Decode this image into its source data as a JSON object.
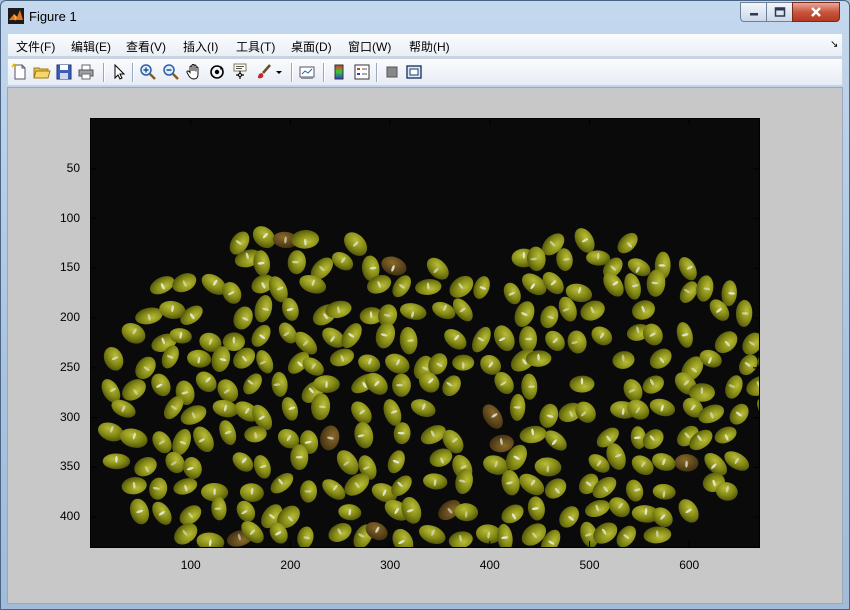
{
  "window": {
    "title": "Figure 1",
    "colors": {
      "close": "#c9553c",
      "frame": "#aac3df"
    }
  },
  "icons": {
    "app": "matlab-logo-icon",
    "minimize": "minimize-icon",
    "maximize": "maximize-icon",
    "close": "close-icon"
  },
  "menu": {
    "items": [
      "文件(F)",
      "编辑(E)",
      "查看(V)",
      "插入(I)",
      "工具(T)",
      "桌面(D)",
      "窗口(W)",
      "帮助(H)"
    ],
    "dock_glyph": "↘"
  },
  "toolbar": {
    "buttons": [
      "new-figure-icon",
      "open-file-icon",
      "save-icon",
      "print-icon",
      "edit-plot-icon",
      "zoom-in-icon",
      "zoom-out-icon",
      "pan-icon",
      "rotate-3d-icon",
      "data-cursor-icon",
      "brush-icon",
      "brush-dropdown-icon",
      "link-plot-icon",
      "insert-colorbar-icon",
      "insert-legend-icon",
      "hide-plot-tools-icon",
      "show-plot-tools-icon"
    ]
  },
  "image_content": {
    "subject": "mung beans on black background",
    "background_color": "#0a0a0a",
    "bean_color": "#8a8f18"
  },
  "axes": {
    "x_ticks": [
      "100",
      "200",
      "300",
      "400",
      "500",
      "600"
    ],
    "y_ticks": [
      "50",
      "100",
      "150",
      "200",
      "250",
      "300",
      "350",
      "400"
    ],
    "x_tick_values": [
      100,
      200,
      300,
      400,
      500,
      600
    ],
    "y_tick_values": [
      50,
      100,
      150,
      200,
      250,
      300,
      350,
      400
    ],
    "xlim": [
      0,
      670
    ],
    "ylim": [
      0,
      430
    ]
  }
}
